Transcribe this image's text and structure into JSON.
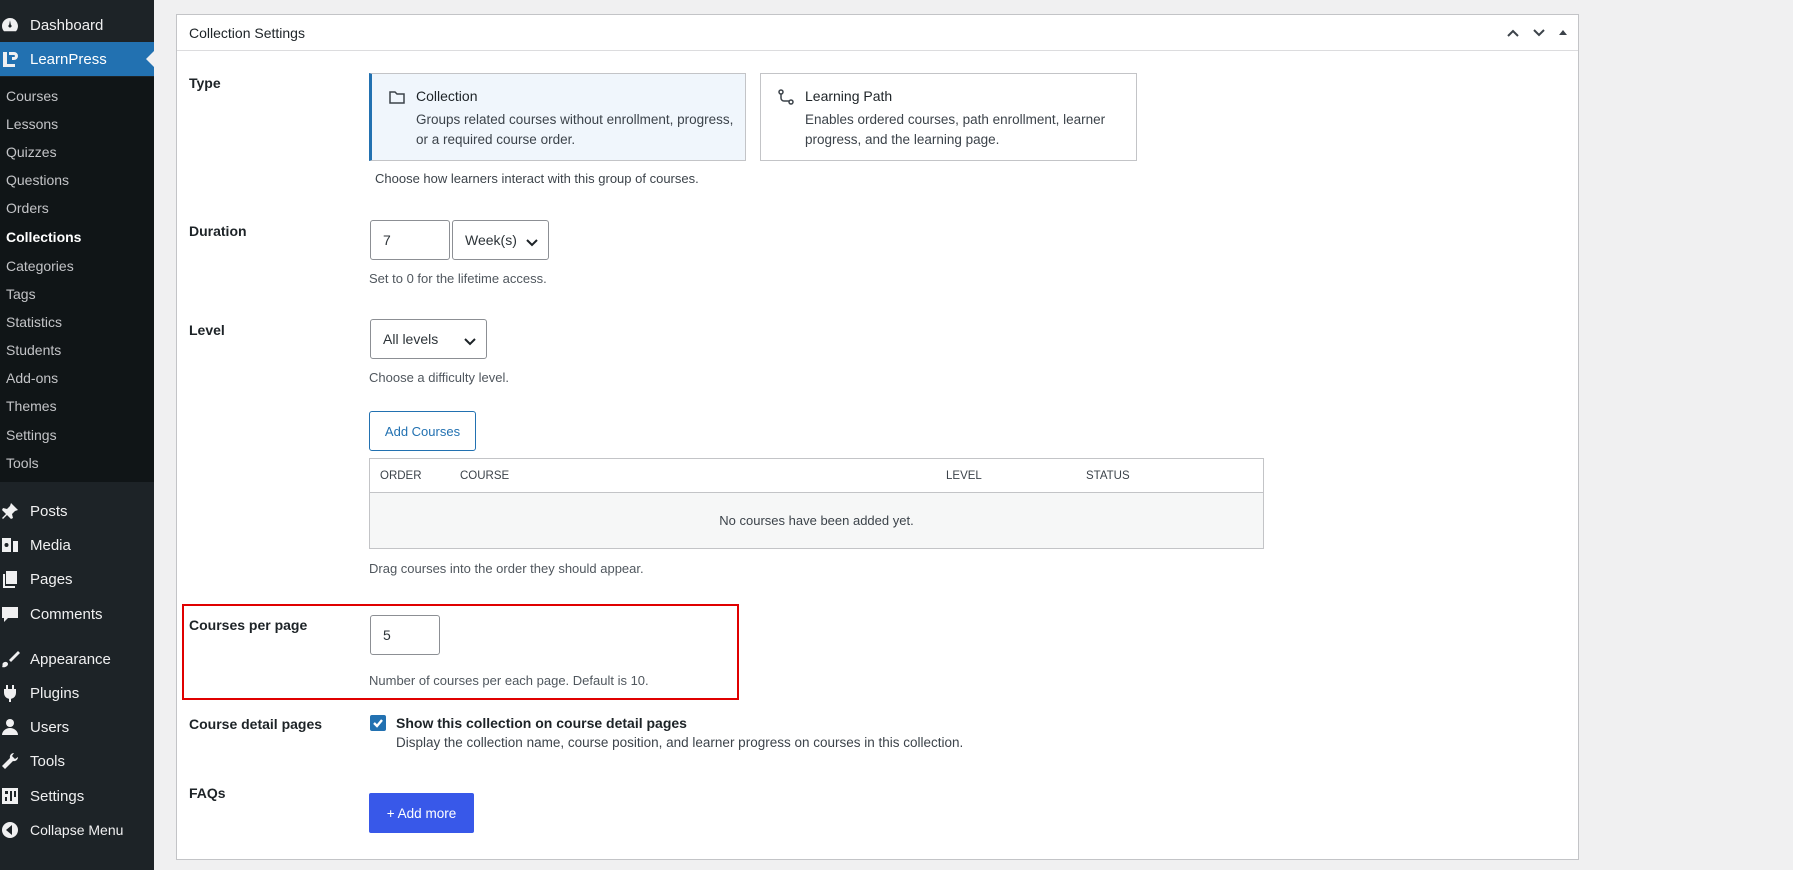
{
  "sidebar": {
    "top": [
      {
        "label": "Dashboard",
        "icon": "dashboard-icon"
      },
      {
        "label": "LearnPress",
        "icon": "learnpress-icon"
      }
    ],
    "submenu": [
      "Courses",
      "Lessons",
      "Quizzes",
      "Questions",
      "Orders",
      "Collections",
      "Categories",
      "Tags",
      "Statistics",
      "Students",
      "Add-ons",
      "Themes",
      "Settings",
      "Tools"
    ],
    "current_submenu": "Collections",
    "bottom": [
      {
        "label": "Posts",
        "icon": "pin-icon"
      },
      {
        "label": "Media",
        "icon": "media-icon"
      },
      {
        "label": "Pages",
        "icon": "pages-icon"
      },
      {
        "label": "Comments",
        "icon": "comment-icon"
      },
      {
        "label": "Appearance",
        "icon": "brush-icon"
      },
      {
        "label": "Plugins",
        "icon": "plugin-icon"
      },
      {
        "label": "Users",
        "icon": "user-icon"
      },
      {
        "label": "Tools",
        "icon": "wrench-icon"
      },
      {
        "label": "Settings",
        "icon": "settings-icon"
      },
      {
        "label": "Collapse Menu",
        "icon": "collapse-icon"
      }
    ]
  },
  "panel": {
    "title": "Collection Settings",
    "type": {
      "label": "Type",
      "options": [
        {
          "title": "Collection",
          "desc": "Groups related courses without enrollment, progress, or a required course order.",
          "selected": true
        },
        {
          "title": "Learning Path",
          "desc": "Enables ordered courses, path enrollment, learner progress, and the learning page.",
          "selected": false
        }
      ],
      "help": "Choose how learners interact with this group of courses."
    },
    "duration": {
      "label": "Duration",
      "value": "7",
      "unit": "Week(s)",
      "help": "Set to 0 for the lifetime access."
    },
    "level": {
      "label": "Level",
      "value": "All levels",
      "help": "Choose a difficulty level."
    },
    "courses": {
      "add_button": "Add Courses",
      "columns": [
        "ORDER",
        "COURSE",
        "LEVEL",
        "STATUS"
      ],
      "empty_text": "No courses have been added yet.",
      "help": "Drag courses into the order they should appear."
    },
    "per_page": {
      "label": "Courses per page",
      "value": "5",
      "help": "Number of courses per each page. Default is 10."
    },
    "detail_pages": {
      "label": "Course detail pages",
      "checkbox_label": "Show this collection on course detail pages",
      "checked": true,
      "help": "Display the collection name, course position, and learner progress on courses in this collection."
    },
    "faqs": {
      "label": "FAQs",
      "add_button": "+ Add more"
    }
  },
  "colors": {
    "sidebar_bg": "#1d2327",
    "active_bg": "#2271b1",
    "primary_button": "#3858e9",
    "highlight": "#e00000"
  }
}
